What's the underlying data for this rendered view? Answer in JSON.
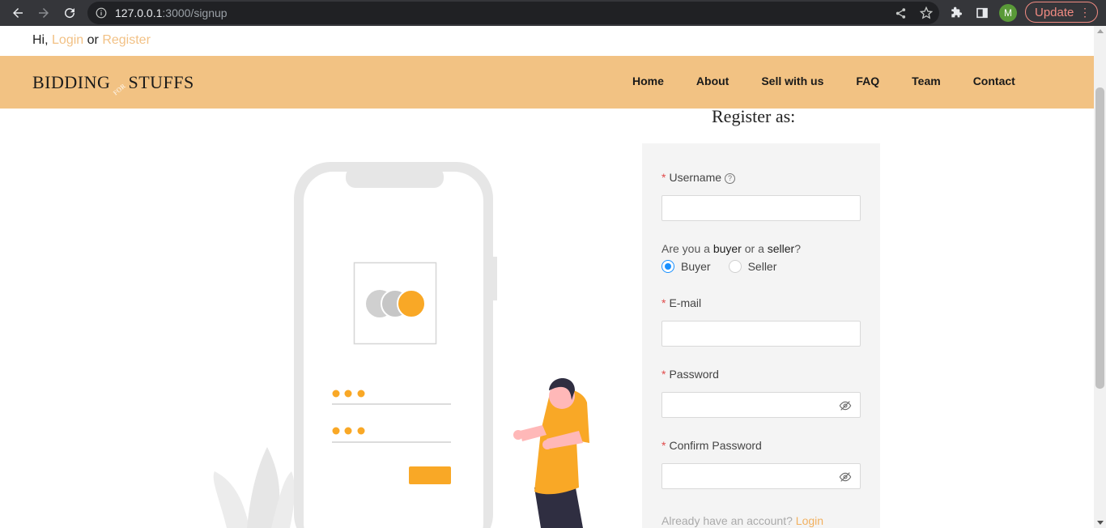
{
  "browser": {
    "url_host": "127.0.0.1",
    "url_path": ":3000/signup",
    "avatar_letter": "M",
    "update_label": "Update"
  },
  "topbar": {
    "greeting": "Hi,",
    "login": "Login",
    "or": "or",
    "register": "Register"
  },
  "header": {
    "logo_left": "BIDDING",
    "logo_for": "FOR",
    "logo_right": "STUFFS",
    "nav": [
      "Home",
      "About",
      "Sell with us",
      "FAQ",
      "Team",
      "Contact"
    ]
  },
  "form": {
    "title": "Register as:",
    "username_label": "Username",
    "question_pre": "Are you a ",
    "question_buyer": "buyer",
    "question_mid": " or a ",
    "question_seller": "seller",
    "question_end": "?",
    "option_buyer": "Buyer",
    "option_seller": "Seller",
    "selected_role": "Buyer",
    "email_label": "E-mail",
    "password_label": "Password",
    "confirm_label": "Confirm Password",
    "already_text": "Already have an account? ",
    "login_link": "Login"
  },
  "colors": {
    "header_bg": "#f2c283",
    "accent": "#f9a826",
    "link": "#f2c185"
  }
}
